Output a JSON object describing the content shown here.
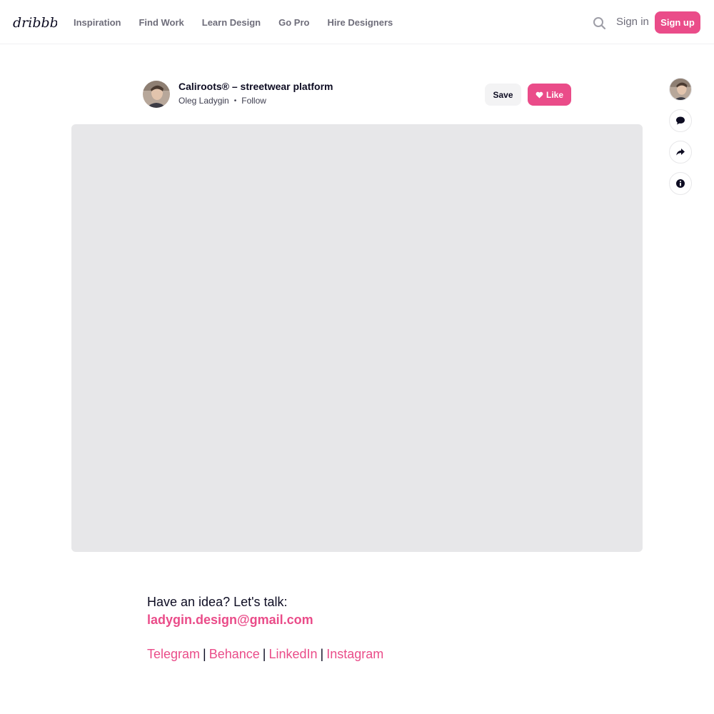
{
  "header": {
    "logo_text": "dribbble",
    "nav": [
      "Inspiration",
      "Find Work",
      "Learn Design",
      "Go Pro",
      "Hire Designers"
    ],
    "sign_in": "Sign in",
    "sign_up": "Sign up"
  },
  "shot": {
    "title": "Caliroots® – streetwear platform",
    "author": "Oleg Ladygin",
    "dot": "•",
    "follow": "Follow",
    "save": "Save",
    "like": "Like"
  },
  "description": {
    "line1": "Have an idea? Let's talk:",
    "email": "ladygin.design@gmail.com",
    "links": [
      "Telegram",
      "Behance",
      "LinkedIn",
      "Instagram"
    ],
    "separator": "|"
  },
  "colors": {
    "accent": "#ea4c89",
    "text": "#0d0c22",
    "muted": "#6e6d7a",
    "placeholder": "#e7e7e9"
  },
  "icons": [
    "search-icon",
    "heart-icon",
    "comment-icon",
    "share-icon",
    "info-icon"
  ]
}
